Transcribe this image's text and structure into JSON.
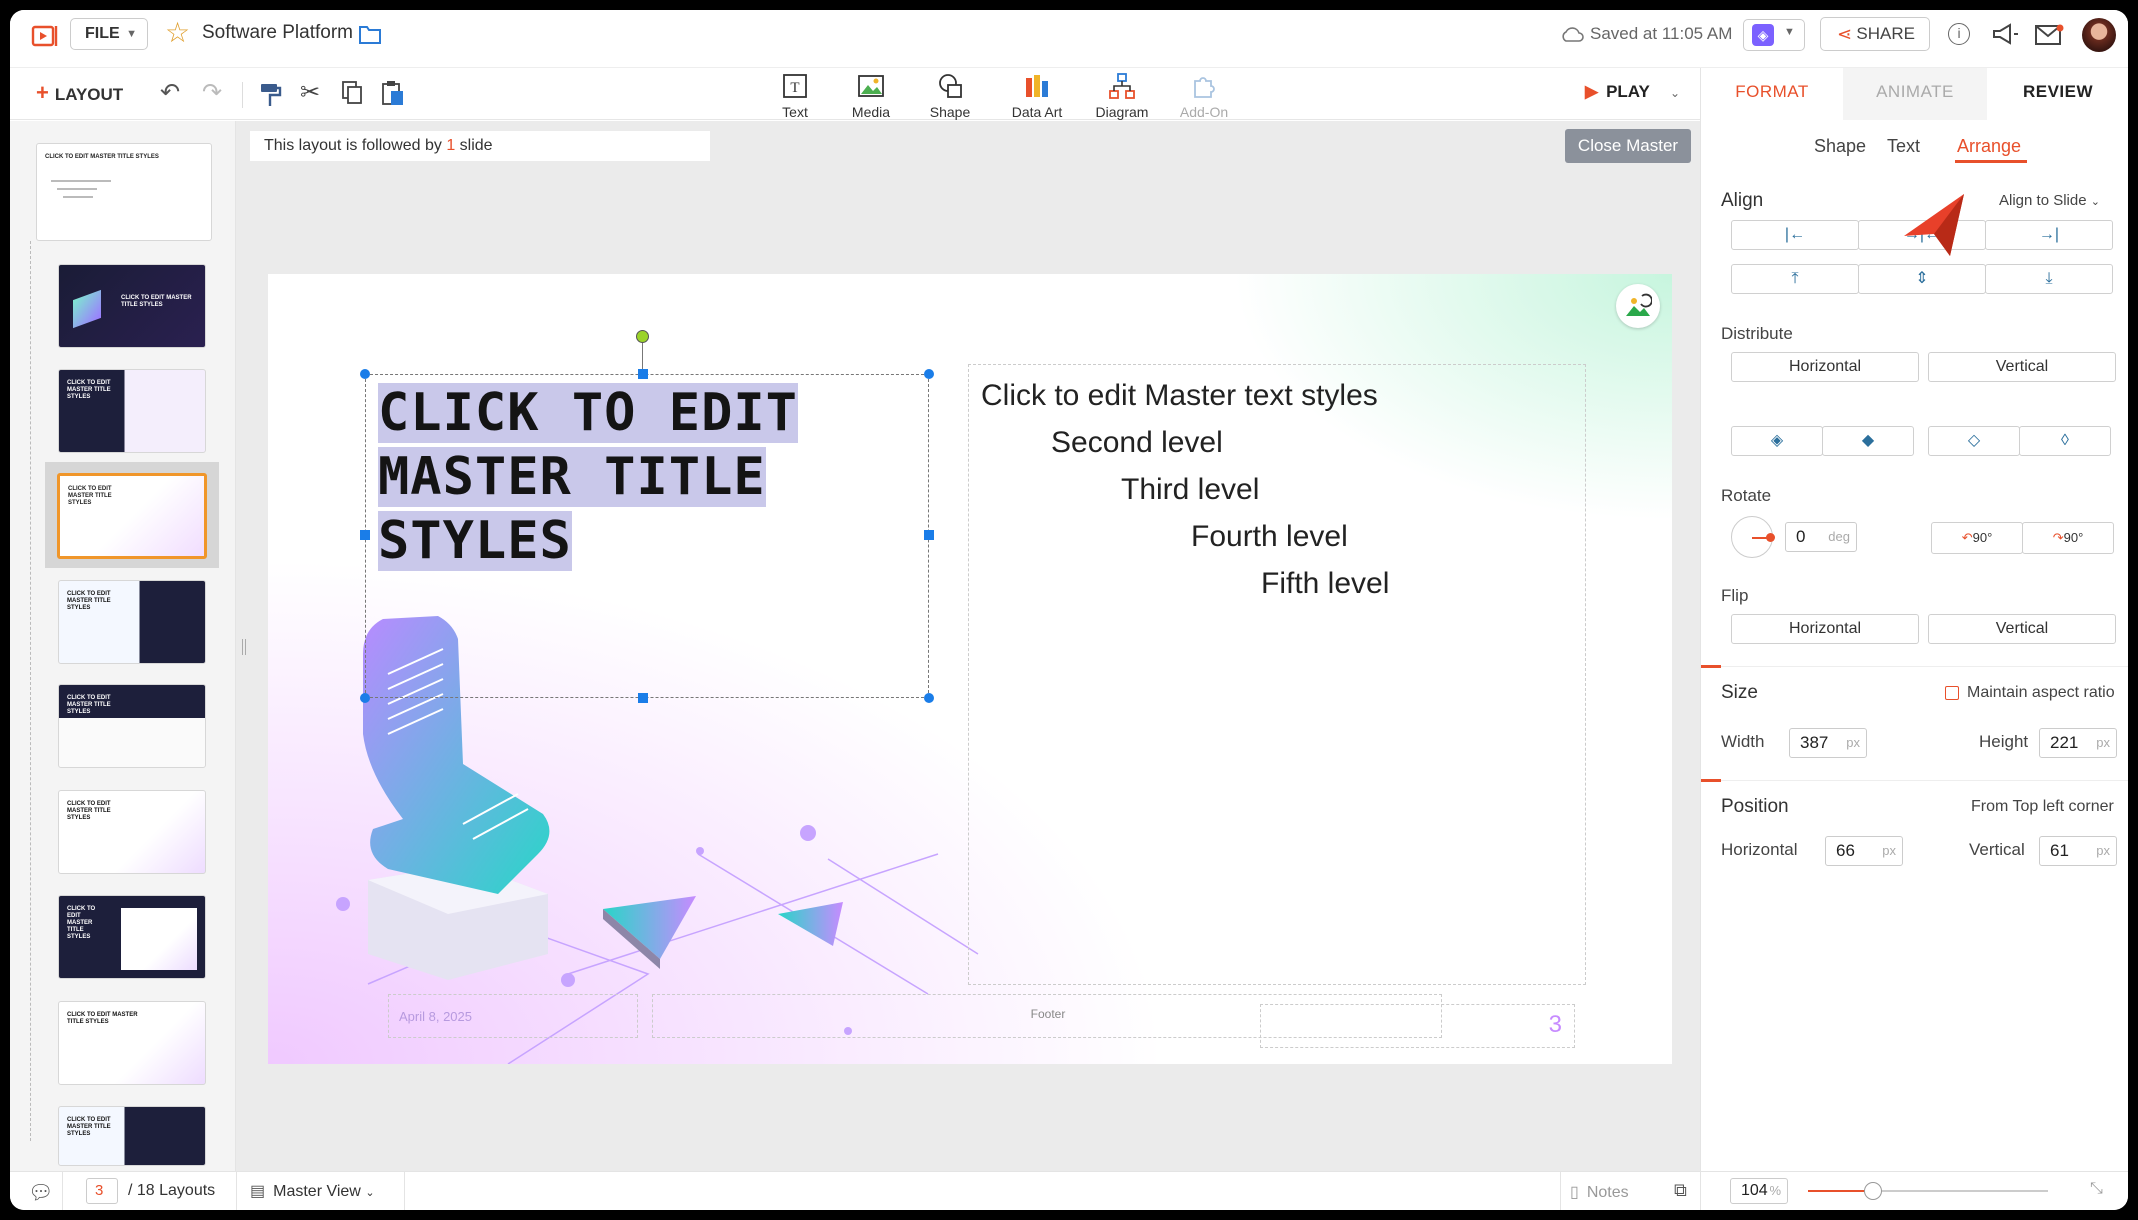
{
  "colors": {
    "accent": "#e8502b",
    "selection": "#1a7de8",
    "master_btn": "#8b919b"
  },
  "header": {
    "file_label": "FILE",
    "title": "Software Platform",
    "saved": "Saved at 11:05 AM",
    "share": "SHARE"
  },
  "toolbar": {
    "layout": "LAYOUT",
    "insert": [
      {
        "icon": "text-icon",
        "label": "Text"
      },
      {
        "icon": "media-icon",
        "label": "Media"
      },
      {
        "icon": "shape-icon",
        "label": "Shape"
      },
      {
        "icon": "data-art-icon",
        "label": "Data Art"
      },
      {
        "icon": "diagram-icon",
        "label": "Diagram"
      },
      {
        "icon": "add-on-icon",
        "label": "Add-On"
      }
    ],
    "play": "PLAY"
  },
  "canvas": {
    "info_prefix": "This layout is followed by",
    "info_count": "1",
    "info_suffix": "slide",
    "close_master": "Close Master"
  },
  "slide": {
    "title": "CLICK TO EDIT MASTER TITLE STYLES",
    "levels": [
      "Click to edit Master text styles",
      "Second level",
      "Third level",
      "Fourth level",
      "Fifth level"
    ],
    "date": "April 8, 2025",
    "footer": "Footer",
    "page": "3"
  },
  "thumbs": [
    {
      "title": "CLICK TO EDIT MASTER TITLE STYLES",
      "dark": false
    },
    {
      "title": "CLICK TO EDIT MASTER TITLE STYLES",
      "dark": true
    },
    {
      "title": "CLICK TO EDIT MASTER TITLE STYLES",
      "dark": true
    },
    {
      "title": "CLICK TO EDIT MASTER TITLE STYLES",
      "dark": false
    },
    {
      "title": "CLICK TO EDIT MASTER TITLE STYLES",
      "dark": false
    },
    {
      "title": "CLICK TO EDIT MASTER TITLE STYLES",
      "dark": true
    },
    {
      "title": "CLICK TO EDIT MASTER TITLE STYLES",
      "dark": false
    },
    {
      "title": "CLICK TO EDIT MASTER TITLE STYLES",
      "dark": true
    },
    {
      "title": "CLICK TO EDIT MASTER TITLE STYLES",
      "dark": false
    },
    {
      "title": "CLICK TO EDIT MASTER TITLE STYLES",
      "dark": true
    }
  ],
  "panel": {
    "tabs": [
      "FORMAT",
      "ANIMATE",
      "REVIEW"
    ],
    "subtabs": [
      "Shape",
      "Text",
      "Arrange"
    ],
    "align": "Align",
    "align_to": "Align to Slide",
    "distribute": "Distribute",
    "horizontal": "Horizontal",
    "vertical": "Vertical",
    "rotate": "Rotate",
    "rotate_value": "0",
    "deg": "deg",
    "rot_ccw": "90°",
    "rot_cw": "90°",
    "flip": "Flip",
    "size": "Size",
    "maintain": "Maintain aspect ratio",
    "width_label": "Width",
    "width": "387",
    "height_label": "Height",
    "height": "221",
    "px": "px",
    "position": "Position",
    "from": "From Top left corner",
    "h_label": "Horizontal",
    "h_value": "66",
    "v_label": "Vertical",
    "v_value": "61"
  },
  "status": {
    "page": "3",
    "layouts": "/ 18 Layouts",
    "view": "Master View",
    "notes": "Notes",
    "zoom": "104",
    "zoom_unit": "%",
    "zoom_level": 0.27
  }
}
